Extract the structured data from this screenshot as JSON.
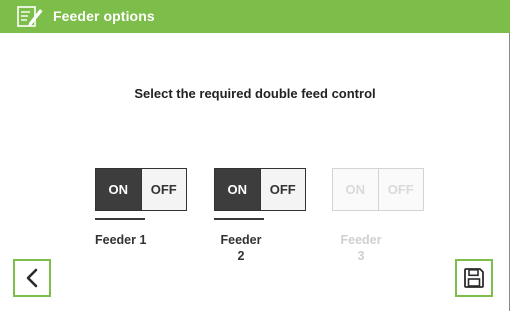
{
  "header": {
    "title": "Feeder options",
    "icon": "edit-settings-icon",
    "color": "#7dbd4a"
  },
  "instruction": "Select the required double feed control",
  "feeders": [
    {
      "label_line1": "Feeder 1",
      "label_line2": "",
      "on_label": "ON",
      "off_label": "OFF",
      "selected": "ON",
      "enabled": true
    },
    {
      "label_line1": "Feeder",
      "label_line2": "2",
      "on_label": "ON",
      "off_label": "OFF",
      "selected": "ON",
      "enabled": true
    },
    {
      "label_line1": "Feeder",
      "label_line2": "3",
      "on_label": "ON",
      "off_label": "OFF",
      "selected": "",
      "enabled": false
    }
  ],
  "footer": {
    "back_icon": "chevron-left-icon",
    "save_icon": "save-icon"
  }
}
